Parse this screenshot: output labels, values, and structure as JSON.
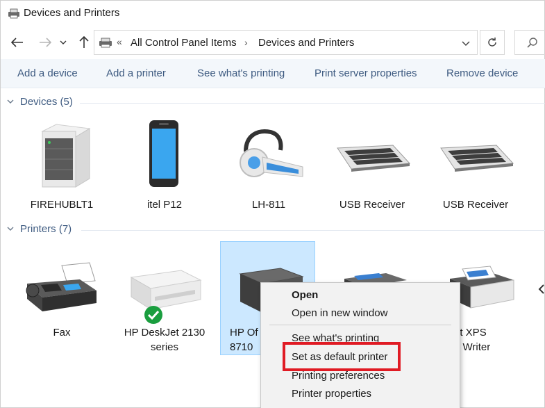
{
  "window": {
    "title": "Devices and Printers",
    "icon": "devices-printers-icon"
  },
  "navigation": {
    "back_icon": "arrow-left-icon",
    "forward_icon": "arrow-right-icon",
    "recent_icon": "chevron-down-icon",
    "up_icon": "arrow-up-icon",
    "refresh_icon": "refresh-icon",
    "search_icon": "search-icon"
  },
  "address": {
    "overflow": "«",
    "crumbs": [
      "All Control Panel Items",
      "Devices and Printers"
    ],
    "separator": "›"
  },
  "commands": [
    "Add a device",
    "Add a printer",
    "See what's printing",
    "Print server properties",
    "Remove device"
  ],
  "groups": {
    "devices": {
      "label": "Devices (5)",
      "items": [
        {
          "name": "FIREHUBLT1",
          "icon": "computer-tower-icon"
        },
        {
          "name": "itel P12",
          "icon": "smartphone-icon"
        },
        {
          "name": "LH-811",
          "icon": "bluetooth-headset-icon"
        },
        {
          "name": "USB Receiver",
          "icon": "keyboard-icon"
        },
        {
          "name": "USB Receiver",
          "icon": "keyboard-icon"
        }
      ]
    },
    "printers": {
      "label": "Printers (7)",
      "items": [
        {
          "name": "Fax",
          "icon": "fax-machine-icon"
        },
        {
          "name": "HP DeskJet 2130 series",
          "icon": "printer-icon",
          "default": true
        },
        {
          "name": "HP Of... 8710",
          "line1": "HP Of",
          "line2": "8710",
          "icon": "printer-icon",
          "selected": true
        },
        {
          "name": "",
          "icon": "printer-icon"
        },
        {
          "name": "...rosoft XPS ...ment Writer",
          "line1": "rosoft XPS",
          "line2": "ment Writer",
          "icon": "printer-icon"
        }
      ]
    }
  },
  "context_menu": {
    "items": [
      {
        "label": "Open",
        "bold": true
      },
      {
        "label": "Open in new window"
      },
      {
        "label": "See what's printing"
      },
      {
        "label": "Set as default printer",
        "highlighted": true
      },
      {
        "label": "Printing preferences"
      },
      {
        "label": "Printer properties"
      }
    ]
  },
  "colors": {
    "accent": "#3d5a80",
    "selection": "#cce8ff",
    "highlight_border": "#e01b24",
    "default_badge": "#1a9e3f"
  }
}
